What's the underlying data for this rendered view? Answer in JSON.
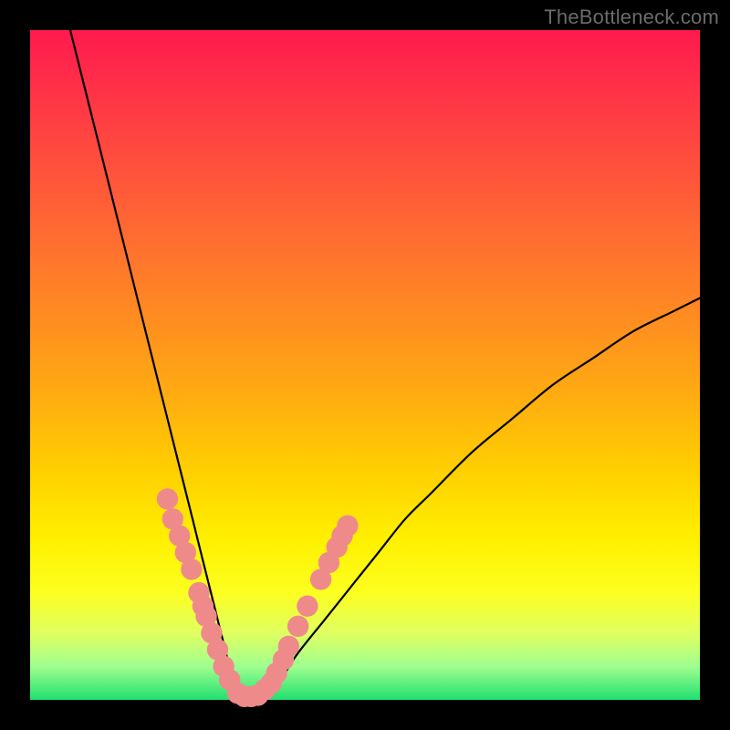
{
  "watermark": "TheBottleneck.com",
  "chart_data": {
    "type": "line",
    "title": "",
    "xlabel": "",
    "ylabel": "",
    "xlim": [
      0,
      100
    ],
    "ylim": [
      0,
      100
    ],
    "grid": false,
    "legend": false,
    "series": [
      {
        "name": "bottleneck-curve",
        "x": [
          6,
          8,
          10,
          12,
          14,
          16,
          18,
          20,
          22,
          24,
          25,
          26,
          27,
          28,
          29,
          30,
          31,
          32,
          33,
          34,
          36,
          38,
          40,
          44,
          48,
          52,
          56,
          60,
          66,
          72,
          78,
          84,
          90,
          96,
          100
        ],
        "y": [
          100,
          92,
          84,
          76,
          68,
          60,
          52,
          44,
          36,
          28,
          24,
          20,
          16,
          12,
          8,
          4,
          1,
          0,
          0,
          0,
          2,
          4,
          7,
          12,
          17,
          22,
          27,
          31,
          37,
          42,
          47,
          51,
          55,
          58,
          60
        ]
      }
    ],
    "optimum_x": 32,
    "markers": {
      "name": "highlighted-points",
      "color": "#ef8a8a",
      "radius_pct": 1.6,
      "points": [
        {
          "x": 20.5,
          "y": 30.0
        },
        {
          "x": 21.3,
          "y": 27.0
        },
        {
          "x": 22.3,
          "y": 24.5
        },
        {
          "x": 23.2,
          "y": 22.0
        },
        {
          "x": 24.1,
          "y": 19.5
        },
        {
          "x": 25.2,
          "y": 16.0
        },
        {
          "x": 25.8,
          "y": 14.0
        },
        {
          "x": 26.3,
          "y": 12.5
        },
        {
          "x": 27.1,
          "y": 10.0
        },
        {
          "x": 28.0,
          "y": 7.5
        },
        {
          "x": 28.9,
          "y": 5.0
        },
        {
          "x": 29.8,
          "y": 3.0
        },
        {
          "x": 31.0,
          "y": 1.0
        },
        {
          "x": 32.0,
          "y": 0.5
        },
        {
          "x": 33.0,
          "y": 0.5
        },
        {
          "x": 34.0,
          "y": 0.7
        },
        {
          "x": 35.0,
          "y": 1.5
        },
        {
          "x": 36.0,
          "y": 2.5
        },
        {
          "x": 36.8,
          "y": 4.0
        },
        {
          "x": 37.8,
          "y": 6.0
        },
        {
          "x": 38.6,
          "y": 8.0
        },
        {
          "x": 40.0,
          "y": 11.0
        },
        {
          "x": 41.4,
          "y": 14.0
        },
        {
          "x": 43.4,
          "y": 18.0
        },
        {
          "x": 44.6,
          "y": 20.5
        },
        {
          "x": 45.8,
          "y": 22.8
        },
        {
          "x": 46.6,
          "y": 24.5
        },
        {
          "x": 47.4,
          "y": 26.0
        }
      ]
    }
  }
}
